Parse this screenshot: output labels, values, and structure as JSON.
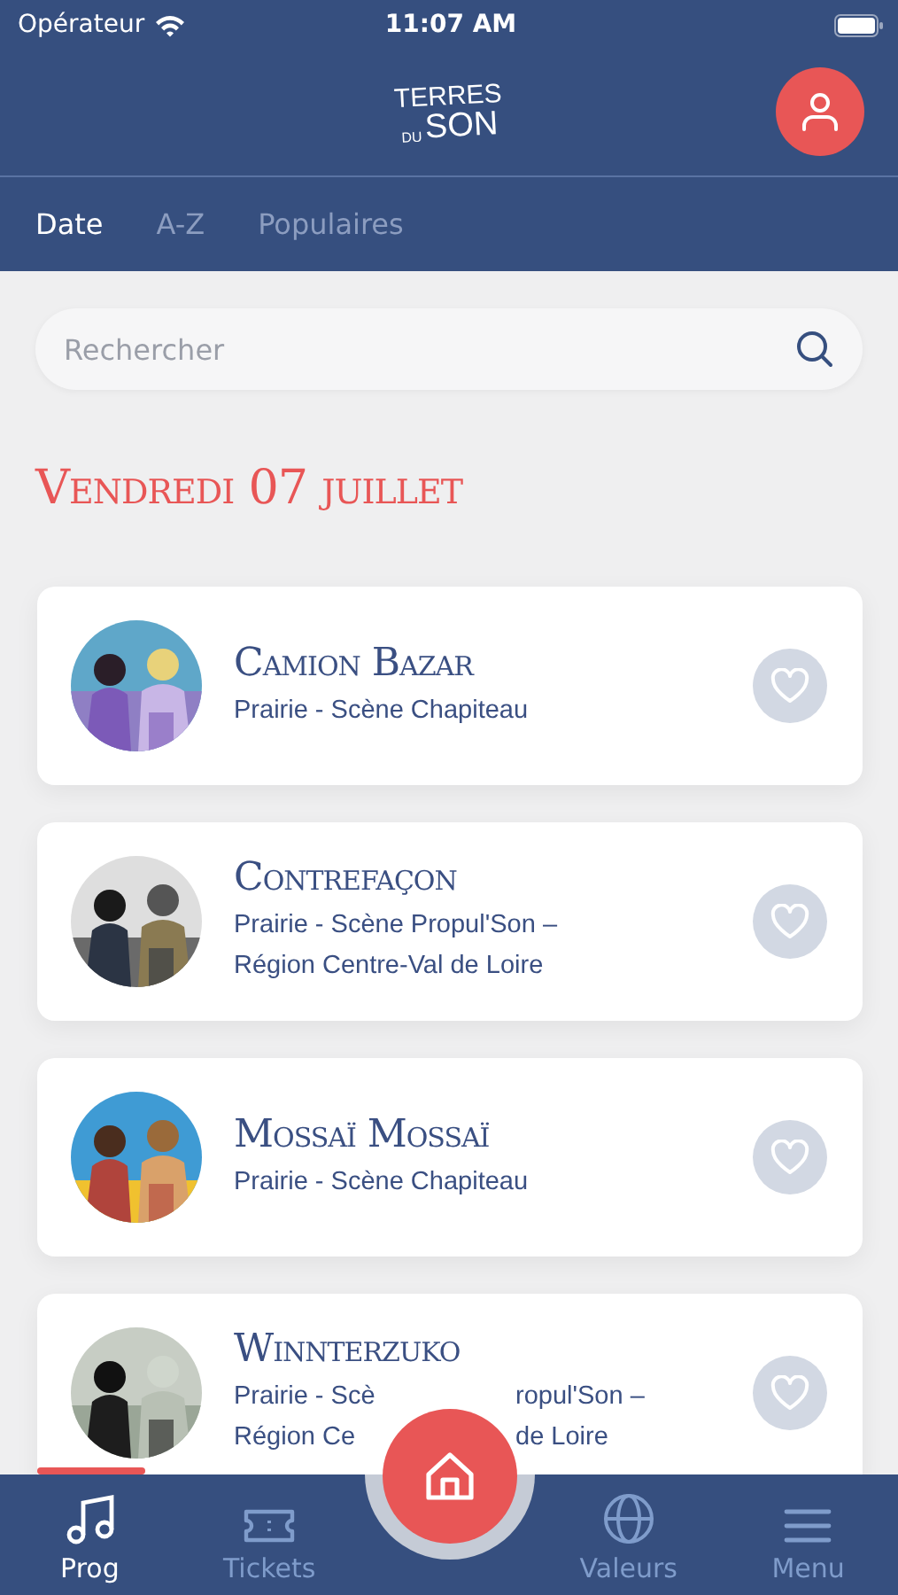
{
  "status_bar": {
    "carrier": "Opérateur",
    "time": "11:07 AM"
  },
  "header": {
    "logo": {
      "top": "TERRES",
      "small": "DU",
      "bottom": "SON"
    }
  },
  "tabs": [
    {
      "label": "Date",
      "selected": true
    },
    {
      "label": "A-Z",
      "selected": false
    },
    {
      "label": "Populaires",
      "selected": false
    }
  ],
  "search": {
    "placeholder": "Rechercher"
  },
  "day_heading": "Vendredi 07 juillet",
  "artists": [
    {
      "name": "Camion Bazar",
      "venue_lines": [
        [
          "Prairie - Scène Chapiteau"
        ]
      ]
    },
    {
      "name": "Contrefaçon",
      "venue_lines": [
        [
          "Prairie - Scène Propul'Son –"
        ],
        [
          "Région Centre-Val de Loire"
        ]
      ]
    },
    {
      "name": "Mossaï Mossaï",
      "venue_lines": [
        [
          "Prairie - Scène Chapiteau"
        ]
      ]
    },
    {
      "name": "Winnterzuko",
      "venue_lines": [
        [
          "Prairie - Scè",
          "ropul'Son –"
        ],
        [
          "Région Ce",
          "de Loire"
        ]
      ]
    }
  ],
  "nav": [
    {
      "kind": "music",
      "label": "Prog",
      "selected": true
    },
    {
      "kind": "ticket",
      "label": "Tickets",
      "selected": false
    },
    {
      "kind": "home",
      "selected": false
    },
    {
      "kind": "globe",
      "label": "Valeurs",
      "selected": false
    },
    {
      "kind": "menu",
      "label": "Menu",
      "selected": false
    }
  ]
}
